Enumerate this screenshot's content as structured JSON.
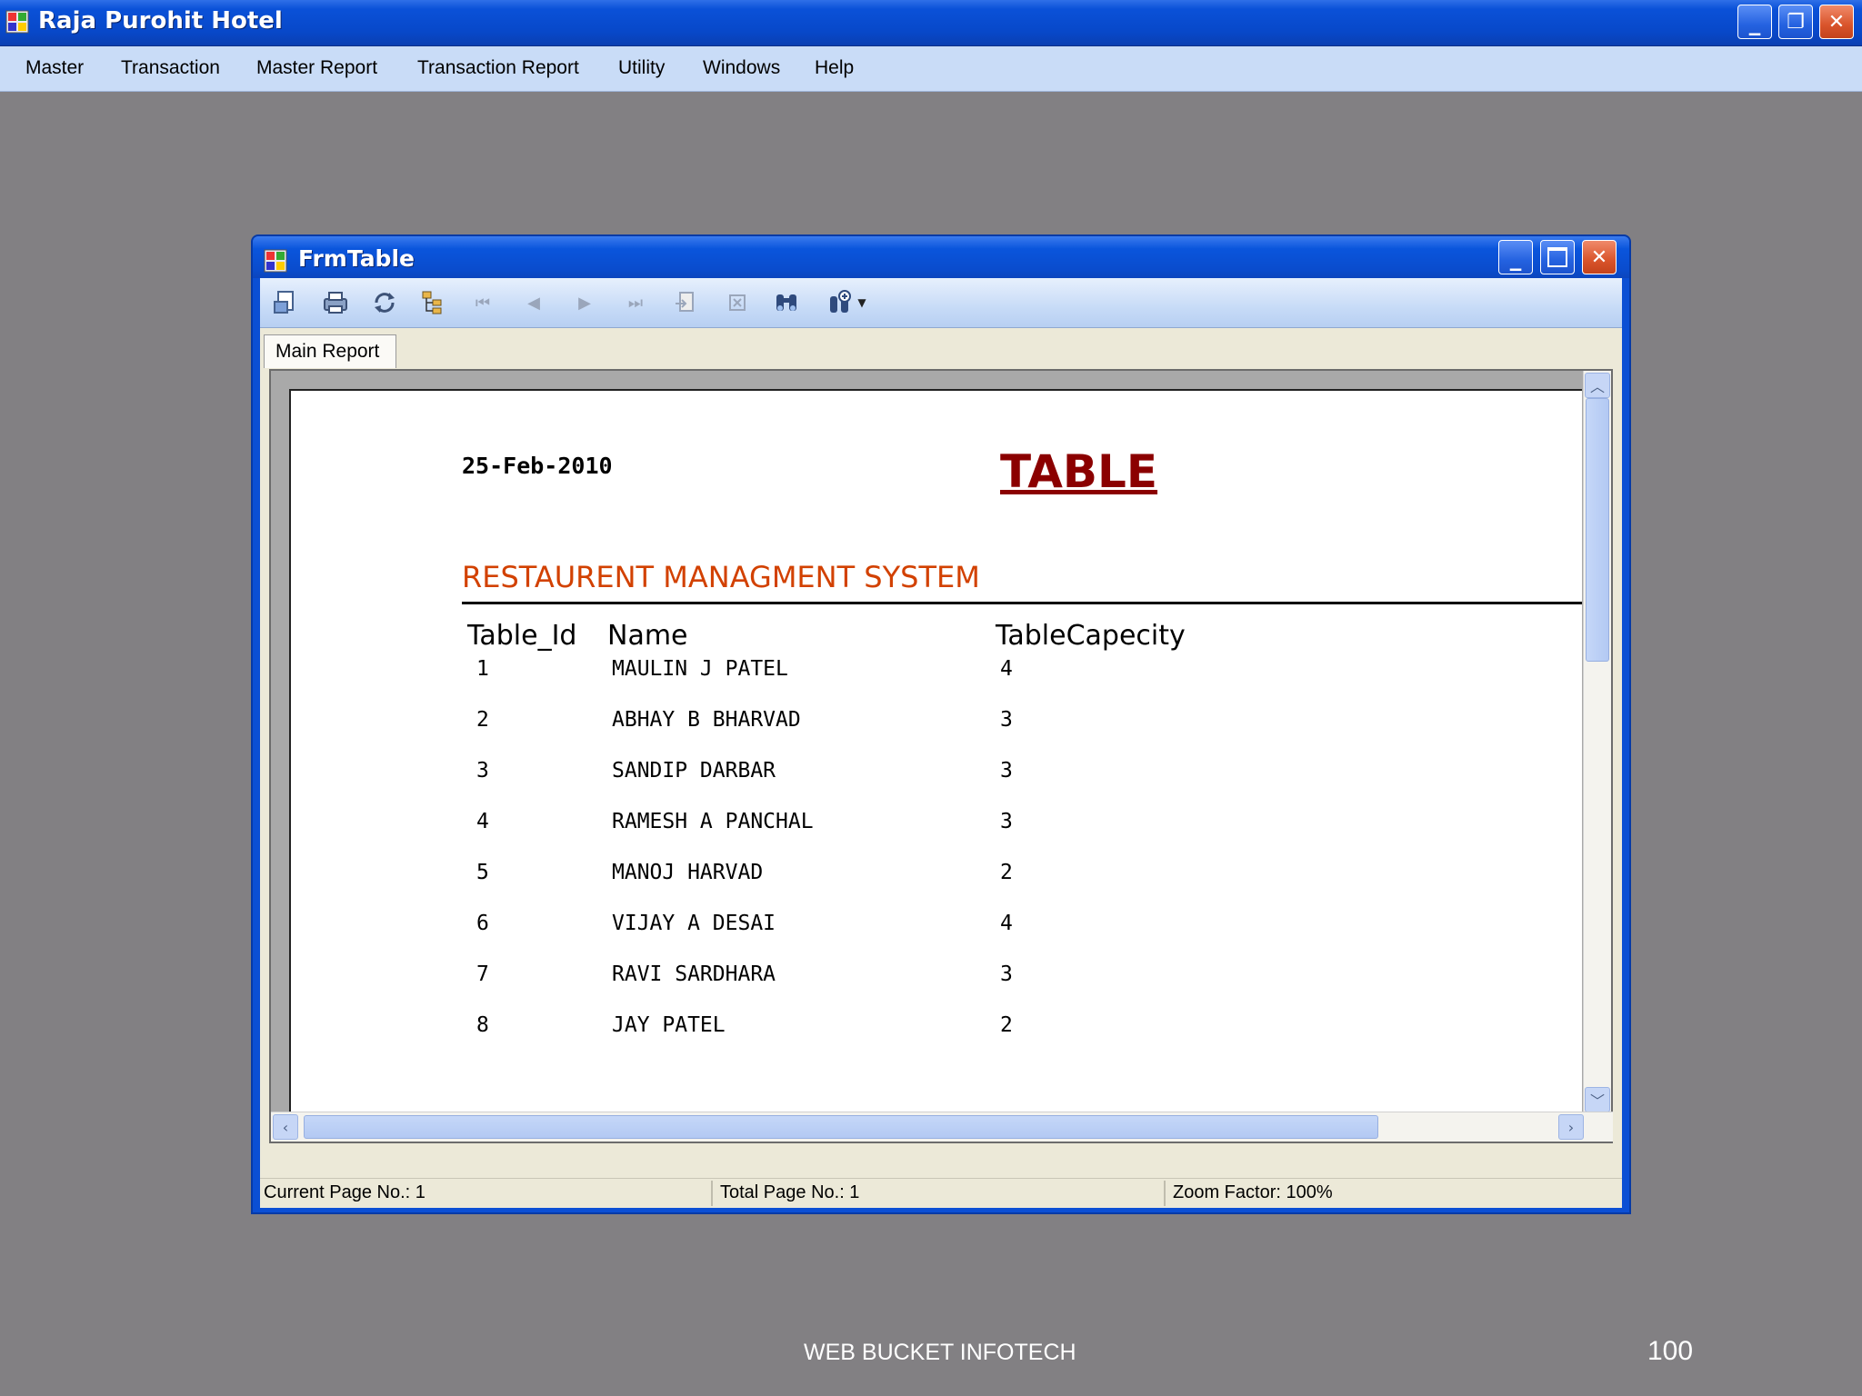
{
  "app": {
    "title": "Raja Purohit Hotel",
    "minimize": "▁",
    "restore": "❐",
    "close": "✕"
  },
  "menu": [
    "Master",
    "Transaction",
    "Master Report",
    "Transaction Report",
    "Utility",
    "Windows",
    "Help"
  ],
  "child": {
    "title": "FrmTable",
    "tab_label": "Main Report"
  },
  "toolbar": {
    "icons": [
      "export-icon",
      "print-icon",
      "refresh-icon",
      "group-tree-icon",
      "first-page-icon",
      "previous-page-icon",
      "next-page-icon",
      "last-page-icon",
      "goto-page-icon",
      "stop-icon",
      "search-icon",
      "zoom-icon"
    ]
  },
  "report": {
    "date": "25-Feb-2010",
    "title": "TABLE",
    "subtitle": "RESTAURENT MANAGMENT SYSTEM",
    "columns": [
      "Table_Id",
      "Name",
      "TableCapecity"
    ],
    "rows": [
      [
        "1",
        "MAULIN J PATEL",
        "4"
      ],
      [
        "2",
        "ABHAY B BHARVAD",
        "3"
      ],
      [
        "3",
        "SANDIP DARBAR",
        "3"
      ],
      [
        "4",
        "RAMESH A PANCHAL",
        "3"
      ],
      [
        "5",
        "MANOJ HARVAD",
        "2"
      ],
      [
        "6",
        "VIJAY A DESAI",
        "4"
      ],
      [
        "7",
        "RAVI SARDHARA",
        "3"
      ],
      [
        "8",
        "JAY PATEL",
        "2"
      ]
    ]
  },
  "status": {
    "current_page": "Current Page No.: 1",
    "total_page": "Total Page No.: 1",
    "zoom": "Zoom Factor: 100%"
  },
  "footer": {
    "company": "WEB BUCKET INFOTECH",
    "page_number": "100"
  }
}
